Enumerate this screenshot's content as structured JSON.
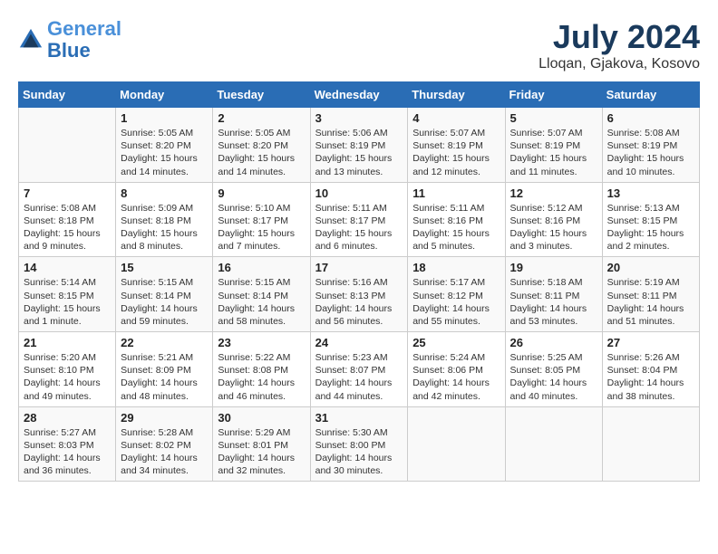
{
  "header": {
    "logo_line1": "General",
    "logo_line2": "Blue",
    "month_title": "July 2024",
    "location": "Lloqan, Gjakova, Kosovo"
  },
  "weekdays": [
    "Sunday",
    "Monday",
    "Tuesday",
    "Wednesday",
    "Thursday",
    "Friday",
    "Saturday"
  ],
  "weeks": [
    [
      {
        "day": "",
        "info": ""
      },
      {
        "day": "1",
        "info": "Sunrise: 5:05 AM\nSunset: 8:20 PM\nDaylight: 15 hours\nand 14 minutes."
      },
      {
        "day": "2",
        "info": "Sunrise: 5:05 AM\nSunset: 8:20 PM\nDaylight: 15 hours\nand 14 minutes."
      },
      {
        "day": "3",
        "info": "Sunrise: 5:06 AM\nSunset: 8:19 PM\nDaylight: 15 hours\nand 13 minutes."
      },
      {
        "day": "4",
        "info": "Sunrise: 5:07 AM\nSunset: 8:19 PM\nDaylight: 15 hours\nand 12 minutes."
      },
      {
        "day": "5",
        "info": "Sunrise: 5:07 AM\nSunset: 8:19 PM\nDaylight: 15 hours\nand 11 minutes."
      },
      {
        "day": "6",
        "info": "Sunrise: 5:08 AM\nSunset: 8:19 PM\nDaylight: 15 hours\nand 10 minutes."
      }
    ],
    [
      {
        "day": "7",
        "info": "Sunrise: 5:08 AM\nSunset: 8:18 PM\nDaylight: 15 hours\nand 9 minutes."
      },
      {
        "day": "8",
        "info": "Sunrise: 5:09 AM\nSunset: 8:18 PM\nDaylight: 15 hours\nand 8 minutes."
      },
      {
        "day": "9",
        "info": "Sunrise: 5:10 AM\nSunset: 8:17 PM\nDaylight: 15 hours\nand 7 minutes."
      },
      {
        "day": "10",
        "info": "Sunrise: 5:11 AM\nSunset: 8:17 PM\nDaylight: 15 hours\nand 6 minutes."
      },
      {
        "day": "11",
        "info": "Sunrise: 5:11 AM\nSunset: 8:16 PM\nDaylight: 15 hours\nand 5 minutes."
      },
      {
        "day": "12",
        "info": "Sunrise: 5:12 AM\nSunset: 8:16 PM\nDaylight: 15 hours\nand 3 minutes."
      },
      {
        "day": "13",
        "info": "Sunrise: 5:13 AM\nSunset: 8:15 PM\nDaylight: 15 hours\nand 2 minutes."
      }
    ],
    [
      {
        "day": "14",
        "info": "Sunrise: 5:14 AM\nSunset: 8:15 PM\nDaylight: 15 hours\nand 1 minute."
      },
      {
        "day": "15",
        "info": "Sunrise: 5:15 AM\nSunset: 8:14 PM\nDaylight: 14 hours\nand 59 minutes."
      },
      {
        "day": "16",
        "info": "Sunrise: 5:15 AM\nSunset: 8:14 PM\nDaylight: 14 hours\nand 58 minutes."
      },
      {
        "day": "17",
        "info": "Sunrise: 5:16 AM\nSunset: 8:13 PM\nDaylight: 14 hours\nand 56 minutes."
      },
      {
        "day": "18",
        "info": "Sunrise: 5:17 AM\nSunset: 8:12 PM\nDaylight: 14 hours\nand 55 minutes."
      },
      {
        "day": "19",
        "info": "Sunrise: 5:18 AM\nSunset: 8:11 PM\nDaylight: 14 hours\nand 53 minutes."
      },
      {
        "day": "20",
        "info": "Sunrise: 5:19 AM\nSunset: 8:11 PM\nDaylight: 14 hours\nand 51 minutes."
      }
    ],
    [
      {
        "day": "21",
        "info": "Sunrise: 5:20 AM\nSunset: 8:10 PM\nDaylight: 14 hours\nand 49 minutes."
      },
      {
        "day": "22",
        "info": "Sunrise: 5:21 AM\nSunset: 8:09 PM\nDaylight: 14 hours\nand 48 minutes."
      },
      {
        "day": "23",
        "info": "Sunrise: 5:22 AM\nSunset: 8:08 PM\nDaylight: 14 hours\nand 46 minutes."
      },
      {
        "day": "24",
        "info": "Sunrise: 5:23 AM\nSunset: 8:07 PM\nDaylight: 14 hours\nand 44 minutes."
      },
      {
        "day": "25",
        "info": "Sunrise: 5:24 AM\nSunset: 8:06 PM\nDaylight: 14 hours\nand 42 minutes."
      },
      {
        "day": "26",
        "info": "Sunrise: 5:25 AM\nSunset: 8:05 PM\nDaylight: 14 hours\nand 40 minutes."
      },
      {
        "day": "27",
        "info": "Sunrise: 5:26 AM\nSunset: 8:04 PM\nDaylight: 14 hours\nand 38 minutes."
      }
    ],
    [
      {
        "day": "28",
        "info": "Sunrise: 5:27 AM\nSunset: 8:03 PM\nDaylight: 14 hours\nand 36 minutes."
      },
      {
        "day": "29",
        "info": "Sunrise: 5:28 AM\nSunset: 8:02 PM\nDaylight: 14 hours\nand 34 minutes."
      },
      {
        "day": "30",
        "info": "Sunrise: 5:29 AM\nSunset: 8:01 PM\nDaylight: 14 hours\nand 32 minutes."
      },
      {
        "day": "31",
        "info": "Sunrise: 5:30 AM\nSunset: 8:00 PM\nDaylight: 14 hours\nand 30 minutes."
      },
      {
        "day": "",
        "info": ""
      },
      {
        "day": "",
        "info": ""
      },
      {
        "day": "",
        "info": ""
      }
    ]
  ]
}
